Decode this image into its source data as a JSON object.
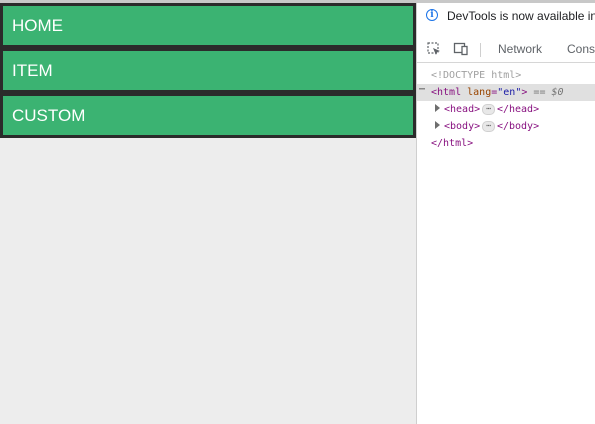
{
  "page": {
    "nav_items": [
      {
        "label": "HOME"
      },
      {
        "label": "ITEM"
      },
      {
        "label": "CUSTOM"
      }
    ]
  },
  "devtools": {
    "info_text": "DevTools is now available in",
    "tabs": [
      {
        "label": "Network"
      },
      {
        "label": "Conso"
      }
    ],
    "dom": {
      "doctype": "<!DOCTYPE html>",
      "html_open": "<html",
      "html_attr_name": "lang",
      "html_attr_value": "\"en\"",
      "html_close_bracket": ">",
      "selected_marker": "== $0",
      "head_open": "<head>",
      "head_close": "</head>",
      "body_open": "<body>",
      "body_close": "</body>",
      "html_close": "</html>",
      "collapsed_dots": "⋯",
      "row_menu_dots": "⋯"
    }
  },
  "colors": {
    "nav_bg": "#3bb372",
    "nav_border": "#2b2b2b",
    "tag": "#881280",
    "attr_name": "#994500",
    "attr_value": "#1a1aa6",
    "info_blue": "#1a73e8"
  },
  "icons": [
    "info-icon",
    "inspect-element-icon",
    "device-toolbar-icon",
    "expand-triangle-icon"
  ]
}
